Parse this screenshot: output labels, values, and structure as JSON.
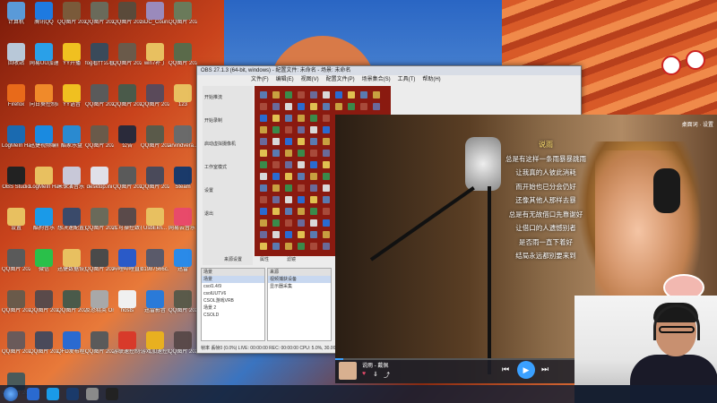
{
  "desktop": {
    "icons": [
      {
        "label": "计算机",
        "color": "#5a9ad8"
      },
      {
        "label": "腾讯QQ",
        "color": "#1e7ae0"
      },
      {
        "label": "QQ图片 20211212...",
        "color": "#7a5a3a"
      },
      {
        "label": "QQ图片 2022016...",
        "color": "#6a6a5a"
      },
      {
        "label": "QQ图片 2022019...",
        "color": "#5a4a3a"
      },
      {
        "label": "SDC_Coun... Online",
        "color": "#9a8abc"
      },
      {
        "label": "QQ图片 20220327...",
        "color": "#6a7a5a"
      },
      {
        "label": "回收站",
        "color": "#b8c8d8"
      },
      {
        "label": "网易UU加速器",
        "color": "#2aa0e8"
      },
      {
        "label": "YY开播",
        "color": "#f0c020"
      },
      {
        "label": "fog看什么看 图.png",
        "color": "#3a4a5a"
      },
      {
        "label": "QQ图片 20220124...",
        "color": "#6a5a4a"
      },
      {
        "label": "win7补丁",
        "color": "#e8c060"
      },
      {
        "label": "QQ图片 20220325...",
        "color": "#5a6a4a"
      },
      {
        "label": "Firefox",
        "color": "#e86a1a"
      },
      {
        "label": "向日葵控制端",
        "color": "#f08a2a"
      },
      {
        "label": "YY语音",
        "color": "#f0c020"
      },
      {
        "label": "QQ图片 20211224...",
        "color": "#5a5a5a"
      },
      {
        "label": "QQ图片 20220120...",
        "color": "#4a5a4a"
      },
      {
        "label": "QQ图片 20220204...",
        "color": "#5a4a5a"
      },
      {
        "label": "123",
        "color": "#e8c060"
      },
      {
        "label": "LogMeIn Hamachi",
        "color": "#1a6ab0"
      },
      {
        "label": "迅捷视频编辑",
        "color": "#1a8ae0"
      },
      {
        "label": "酷家乐盘",
        "color": "#2a8ad0"
      },
      {
        "label": "QQ图片 20220107...",
        "color": "#6a5a4a"
      },
      {
        "label": "公告",
        "color": "#2a2a3a"
      },
      {
        "label": "QQ图片 20220111...",
        "color": "#5a5a4a"
      },
      {
        "label": "arvindvera...",
        "color": "#6a6a6a"
      },
      {
        "label": "OBS Studio",
        "color": "#222222"
      },
      {
        "label": "LogMeIn Hamachi",
        "color": "#e8c060"
      },
      {
        "label": "米保演音乐 png",
        "color": "#c8c8d8"
      },
      {
        "label": "desktop.ini",
        "color": "#e0e0e8"
      },
      {
        "label": "QQ图片 20220126...",
        "color": "#5a5a5a"
      },
      {
        "label": "QQ图片 20220408...",
        "color": "#4a4a5a"
      },
      {
        "label": "Steam",
        "color": "#1a3a6a"
      },
      {
        "label": "设置",
        "color": "#e8c060"
      },
      {
        "label": "酷狗音乐",
        "color": "#1a9ae8"
      },
      {
        "label": "想决速配置置.png",
        "color": "#3a4a6a"
      },
      {
        "label": "QQ图片 2022011...",
        "color": "#6a6a5a"
      },
      {
        "label": "库可操控致界标 祝贺.png",
        "color": "#5a4a4a"
      },
      {
        "label": "UsbEkn...",
        "color": "#e8c060"
      },
      {
        "label": "网易云音乐 工具",
        "color": "#e84a6a"
      },
      {
        "label": "QQ图片 20220105...",
        "color": "#5a5a5a"
      },
      {
        "label": "微信",
        "color": "#2ac04a"
      },
      {
        "label": "迅捷数据恢复",
        "color": "#e8c060"
      },
      {
        "label": "QQ图片 20220263...",
        "color": "#4a4a4a"
      },
      {
        "label": "哔哩哔哩直播姬",
        "color": "#2a5ac8"
      },
      {
        "label": "d1987566c...",
        "color": "#5a5a6a"
      },
      {
        "label": "迅雷",
        "color": "#2a8ae8"
      },
      {
        "label": "QQ图片 20220118...",
        "color": "#6a5a4a"
      },
      {
        "label": "QQ图片 20220303...",
        "color": "#5a4a4a"
      },
      {
        "label": "QQ图片 20220326...",
        "color": "#4a5a4a"
      },
      {
        "label": "反恐精英 Online",
        "color": "#a8a8a8"
      },
      {
        "label": "hosts",
        "color": "#f0f0f0"
      },
      {
        "label": "迅雷影音",
        "color": "#2a7ad8"
      },
      {
        "label": "QQ图片 20220119...",
        "color": "#5a5a4a"
      },
      {
        "label": "QQ图片 20220209...",
        "color": "#6a5a5a"
      },
      {
        "label": "QQ图片 20220331...",
        "color": "#4a4a5a"
      },
      {
        "label": "QFD发布程序",
        "color": "#2a6ad0"
      },
      {
        "label": "QQ图片 20211203...",
        "color": "#5a5a5a"
      },
      {
        "label": "游联速控制平台",
        "color": "#d83a2a"
      },
      {
        "label": "游戏加速控制平台",
        "color": "#e8b020"
      },
      {
        "label": "QQ图片 20220313...",
        "color": "#5a4a4a"
      },
      {
        "label": "QQ图片 20220330...",
        "color": "#4a5a5a"
      }
    ]
  },
  "obs": {
    "title": "OBS 27.1.3 (64-bit, windows) - 配置文件: 未命名 - 场景: 未命名",
    "menu": [
      "文件(F)",
      "编辑(E)",
      "视图(V)",
      "配置文件(P)",
      "场景集合(S)",
      "工具(T)",
      "帮助(H)"
    ],
    "left_rows": [
      "开始推流",
      "开始录制",
      "启动虚拟摄像机",
      "工作室模式",
      "设置",
      "退出"
    ],
    "tabs": [
      "来源设置",
      "属性",
      "滤镜"
    ],
    "scenes_header": "场景",
    "scenes": [
      "场景",
      "csol1.4/9",
      "csolUUTV6",
      "CSOL游戏VRB",
      "场景 2",
      "CSOLD"
    ],
    "sources_header": "来源",
    "sources": [
      "视频捕获设备",
      "显示器采集"
    ],
    "status": "帧率 丢帧0 (0.0%) LIVE: 00:00:00 REC: 00:00:00 CPU: 5.0%, 30.00 fps"
  },
  "player": {
    "top_right": "桌面词 · 设置",
    "lyrics": [
      "说雨",
      "总是有这样一条雨暴暴跳雨",
      "让我真的人彼此消耗",
      "而开始也已分会仍好",
      "还像其他人那样去暴",
      "总是有无故借口先靠谢好",
      "让借口的人遗憾别者",
      "是否雨一直下着好",
      "结局永远都别要来到"
    ],
    "active_line": 0,
    "song_title": "说雨 - 戴佩",
    "progress": 0.02
  },
  "taskbar": {
    "items": [
      {
        "name": "start-button",
        "color": "#1a4a9a"
      },
      {
        "name": "ie-button",
        "color": "#2a6ad0"
      },
      {
        "name": "kugou-button",
        "color": "#1a9ae8"
      },
      {
        "name": "steam-button",
        "color": "#1a3a6a"
      },
      {
        "name": "cs-button",
        "color": "#8a8a8a"
      },
      {
        "name": "obs-button",
        "color": "#222222"
      }
    ]
  }
}
